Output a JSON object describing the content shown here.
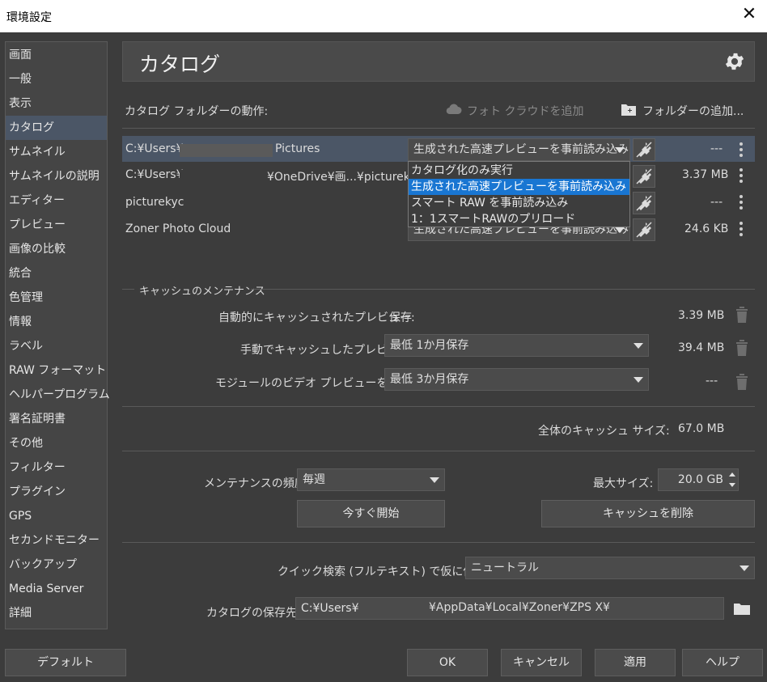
{
  "window": {
    "title": "環境設定",
    "close_glyph": "✕"
  },
  "sidebar": {
    "items": [
      {
        "label": "画面"
      },
      {
        "label": "一般"
      },
      {
        "label": "表示"
      },
      {
        "label": "カタログ",
        "active": true
      },
      {
        "label": "サムネイル"
      },
      {
        "label": "サムネイルの説明"
      },
      {
        "label": "エディター"
      },
      {
        "label": "プレビュー"
      },
      {
        "label": "画像の比較"
      },
      {
        "label": "統合"
      },
      {
        "label": "色管理"
      },
      {
        "label": "情報"
      },
      {
        "label": "ラベル"
      },
      {
        "label": "RAW フォーマット"
      },
      {
        "label": "ヘルパープログラム"
      },
      {
        "label": "署名証明書"
      },
      {
        "label": "その他"
      },
      {
        "label": "フィルター"
      },
      {
        "label": "プラグイン"
      },
      {
        "label": "GPS"
      },
      {
        "label": "セカンドモニター"
      },
      {
        "label": "バックアップ"
      },
      {
        "label": "Media Server"
      },
      {
        "label": "詳細"
      }
    ]
  },
  "header": {
    "title": "カタログ",
    "settings_icon": "gear-icon"
  },
  "catalog": {
    "folder_behavior_label": "カタログ フォルダーの動作:",
    "add_photo_cloud": "フォト クラウドを追加",
    "add_folder": "フォルダーの追加...",
    "rows": [
      {
        "path_prefix": "C:¥Users¥",
        "path_suffix": "Pictures",
        "mode": "生成された高速プレビューを事前読み込み",
        "size": "---"
      },
      {
        "path_prefix": "C:¥Users¥",
        "path_suffix": "¥OneDrive¥画...¥picturek",
        "mode": "",
        "size": "3.37 MB"
      },
      {
        "path_prefix": "picturekyc",
        "path_suffix": "",
        "mode": "",
        "size": "---"
      },
      {
        "path_prefix": "Zoner Photo Cloud",
        "path_suffix": "",
        "mode": "生成された高速プレビューを事前読み込み",
        "size": "24.6 KB"
      }
    ],
    "dropdown_options": [
      {
        "label": "カタログ化のみ実行"
      },
      {
        "label": "生成された高速プレビューを事前読み込み",
        "selected": true
      },
      {
        "label": " スマート RAW を事前読み込み"
      },
      {
        "label": "1：1スマートRAWのプリロード"
      }
    ]
  },
  "cache": {
    "section_title": "キャッシュのメンテナンス",
    "auto_label": "自動的にキャッシュされたプレビュー:",
    "auto_value": "保存",
    "auto_size": "3.39 MB",
    "manual_label": "手動でキャッシュしたプレビュー:",
    "manual_value": "最低 1か月保存",
    "manual_size": "39.4 MB",
    "video_label": "モジュールのビデオ プレビューを作成:",
    "video_value": "最低 3か月保存",
    "video_size": "---",
    "total_label": "全体のキャッシュ サイズ:",
    "total_size": "67.0 MB",
    "frequency_label": "メンテナンスの頻度:",
    "frequency_value": "毎週",
    "max_size_label": "最大サイズ:",
    "max_size_value": "20.0 GB",
    "start_now": "今すぐ開始",
    "delete_cache": "キャッシュを削除"
  },
  "search": {
    "label": "クイック検索 (フルテキスト) で仮に使用:",
    "value": "ニュートラル"
  },
  "storage": {
    "label": "カタログの保存先:",
    "path_prefix": "C:¥Users¥",
    "path_suffix": "¥AppData¥Local¥Zoner¥ZPS X¥"
  },
  "footer": {
    "default": "デフォルト",
    "ok": "OK",
    "cancel": "キャンセル",
    "apply": "適用",
    "help": "ヘルプ"
  },
  "colors": {
    "background": "#3c3c3c",
    "selected_row": "#4b5666",
    "dropdown_highlight": "#1976d2"
  }
}
